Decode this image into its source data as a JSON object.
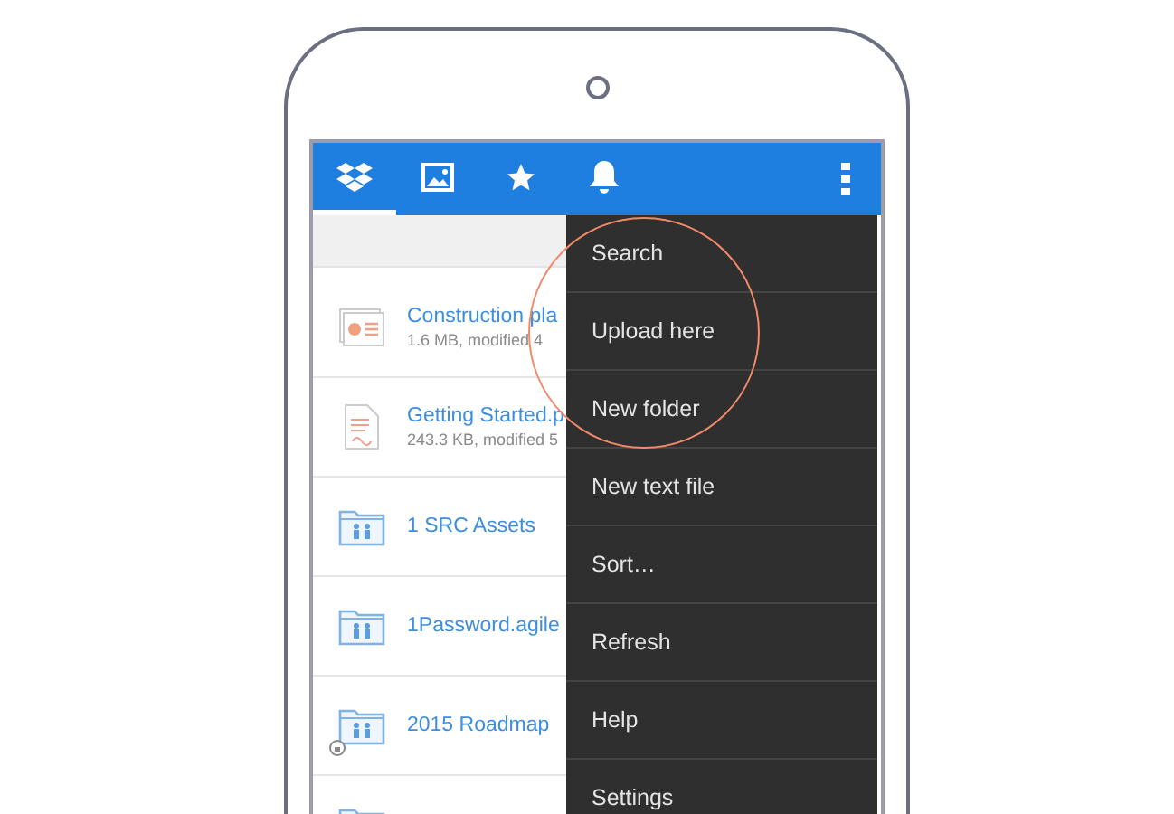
{
  "tabs": [
    {
      "kind": "box",
      "selected": true
    },
    {
      "kind": "image",
      "selected": false
    },
    {
      "kind": "star",
      "selected": false
    },
    {
      "kind": "bell",
      "selected": false
    }
  ],
  "files": [
    {
      "kind": "presentation",
      "name": "Construction pla",
      "meta": "1.6 MB, modified 4",
      "badge": false
    },
    {
      "kind": "document",
      "name": "Getting Started.p",
      "meta": "243.3 KB, modified 5",
      "badge": false
    },
    {
      "kind": "folder",
      "name": "1 SRC Assets",
      "badge": false
    },
    {
      "kind": "folder",
      "name": "1Password.agile",
      "badge": false
    },
    {
      "kind": "folder",
      "name": "2015 Roadmap",
      "badge": true
    },
    {
      "kind": "folder",
      "badge": false
    }
  ],
  "menu": {
    "items": [
      "Search",
      "Upload here",
      "New folder",
      "New text file",
      "Sort…",
      "Refresh",
      "Help",
      "Settings"
    ]
  }
}
